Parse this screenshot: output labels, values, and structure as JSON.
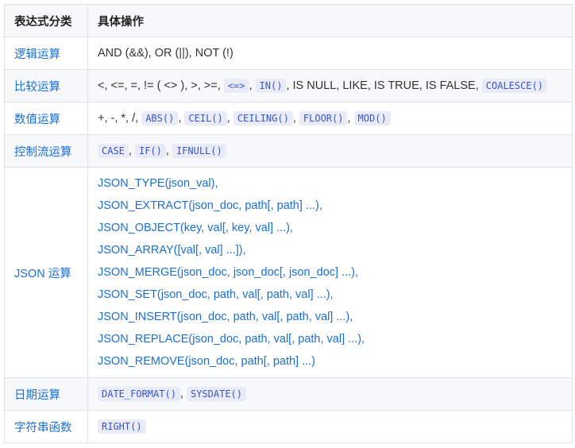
{
  "header": {
    "col1": "表达式分类",
    "col2": "具体操作"
  },
  "rows": [
    {
      "category": "逻辑运算",
      "text": "AND (&&), OR (||), NOT (!)"
    },
    {
      "category": "比较运算",
      "text_a": "<, <=, =, != ( <> ), >, >=,",
      "code_a": "<=>",
      "sep_a": ",",
      "code_b": "IN()",
      "text_b": ", IS NULL, LIKE, IS TRUE, IS FALSE,",
      "code_c": "COALESCE()"
    },
    {
      "category": "数值运算",
      "text_a": "+, -, *, /,",
      "codes": [
        "ABS()",
        "CEIL()",
        "CEILING()",
        "FLOOR()",
        "MOD()"
      ],
      "sep": ","
    },
    {
      "category": "控制流运算",
      "codes": [
        "CASE",
        "IF()",
        "IFNULL()"
      ],
      "sep": ","
    },
    {
      "category": "JSON 运算",
      "lines": [
        "JSON_TYPE(json_val),",
        "JSON_EXTRACT(json_doc, path[, path] ...),",
        "JSON_OBJECT(key, val[, key, val] ...),",
        "JSON_ARRAY([val[, val] ...]),",
        "JSON_MERGE(json_doc, json_doc[, json_doc] ...),",
        "JSON_SET(json_doc, path, val[, path, val] ...),",
        "JSON_INSERT(json_doc, path, val[, path, val] ...),",
        "JSON_REPLACE(json_doc, path, val[, path, val] ...),",
        "JSON_REMOVE(json_doc, path[, path] ...)"
      ]
    },
    {
      "category": "日期运算",
      "codes": [
        "DATE_FORMAT()",
        "SYSDATE()"
      ],
      "sep": ","
    },
    {
      "category": "字符串函数",
      "codes": [
        "RIGHT()"
      ]
    }
  ],
  "colors": {
    "category_text": "#1a6fd6",
    "code_text": "#3a55c8",
    "code_bg": "#e9ecf7",
    "border": "#dfe2e5",
    "stripe": "#f6f8fa"
  }
}
